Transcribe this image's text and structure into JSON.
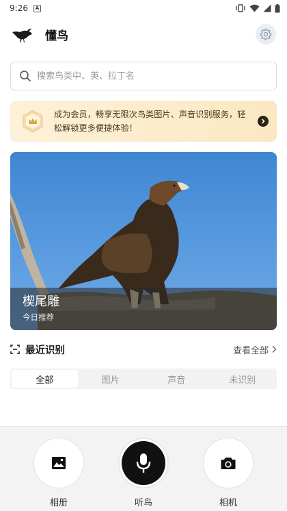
{
  "status_bar": {
    "time": "9:26",
    "notification_letter": "A"
  },
  "header": {
    "title": "懂鸟"
  },
  "search": {
    "placeholder": "搜索鸟类中、英、拉丁名"
  },
  "banner": {
    "text": "成为会员，畅享无限次鸟类图片、声音识别服务，轻松解锁更多便捷体验！"
  },
  "featured": {
    "bird_name": "楔尾雕",
    "subtitle": "今日推荐"
  },
  "recent": {
    "title": "最近识别",
    "view_all": "查看全部",
    "tabs": [
      {
        "label": "全部",
        "active": true
      },
      {
        "label": "图片",
        "active": false
      },
      {
        "label": "声音",
        "active": false
      },
      {
        "label": "未识别",
        "active": false
      }
    ]
  },
  "bottom_actions": [
    {
      "label": "相册",
      "icon": "image-icon"
    },
    {
      "label": "听鸟",
      "icon": "microphone-icon"
    },
    {
      "label": "相机",
      "icon": "camera-icon"
    }
  ],
  "colors": {
    "banner_bg": "#fbe8c2",
    "sky": "#5a9be0",
    "primary_button": "#111111"
  }
}
